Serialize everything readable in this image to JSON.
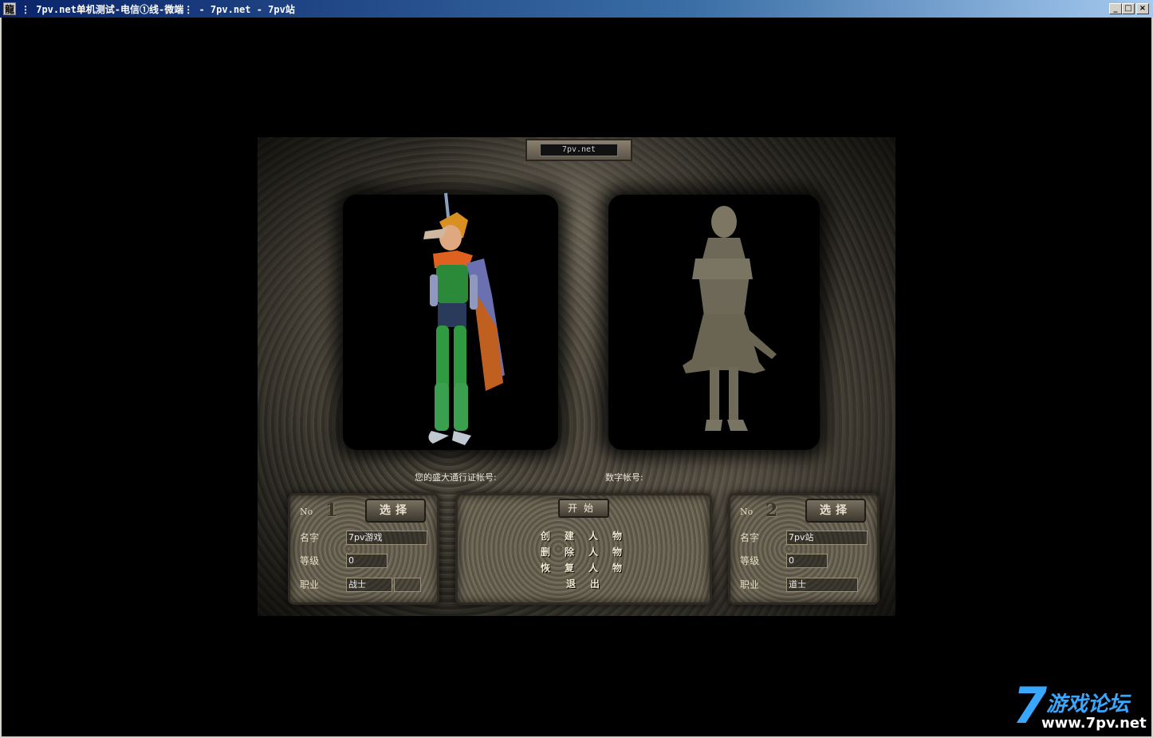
{
  "window": {
    "title": "⋮ 7pv.net单机测试-电信①线-微端⋮ - 7pv.net - 7pv站",
    "icon_char": "龍",
    "minimize": "_",
    "maximize": "□",
    "close": "×"
  },
  "scene": {
    "server_name": "7pv.net",
    "account_label": "您的盛大通行证帐号:",
    "digital_account_label": "数字帐号:"
  },
  "slot1": {
    "no_label": "No",
    "number": "1",
    "select_label": "选择",
    "name_label": "名字",
    "name_value": "7pv游戏",
    "level_label": "等级",
    "level_value": "0",
    "job_label": "职业",
    "job_value": "战士"
  },
  "slot2": {
    "no_label": "No",
    "number": "2",
    "select_label": "选择",
    "name_label": "名字",
    "name_value": "7pv站",
    "level_label": "等级",
    "level_value": "0",
    "job_label": "职业",
    "job_value": "道士"
  },
  "center": {
    "start_label": "开始",
    "create_label": "创建人物",
    "delete_label": "删除人物",
    "restore_label": "恢复人物",
    "exit_label": "退出"
  },
  "watermark": {
    "seven": "7",
    "cn": "游戏论坛",
    "url": "www.7pv.net"
  },
  "colors": {
    "titlebar_start": "#0a246a",
    "titlebar_end": "#a6caf0",
    "stone": "#615a4b",
    "watermark_blue": "#3aa7ff"
  }
}
